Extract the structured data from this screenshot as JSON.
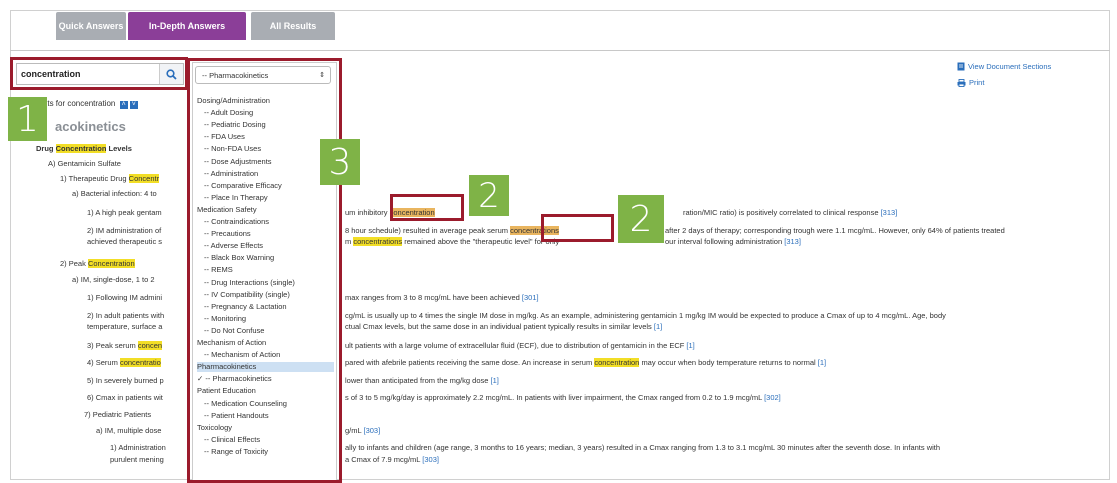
{
  "tabs": [
    "Quick Answers",
    "In-Depth Answers",
    "All Results"
  ],
  "search": {
    "value": "concentration"
  },
  "results_header": "results for concentration",
  "section_heading": "acokinetics",
  "subheading_prefix": "Drug",
  "subheading_hl": "Concentration",
  "subheading_suffix": "Levels",
  "dropdown": {
    "selected": "-- Pharmacokinetics",
    "items": [
      {
        "label": "Dosing/Administration",
        "child": false
      },
      {
        "label": "-- Adult Dosing",
        "child": true
      },
      {
        "label": "-- Pediatric Dosing",
        "child": true
      },
      {
        "label": "-- FDA Uses",
        "child": true
      },
      {
        "label": "-- Non-FDA Uses",
        "child": true
      },
      {
        "label": "-- Dose Adjustments",
        "child": true
      },
      {
        "label": "-- Administration",
        "child": true
      },
      {
        "label": "-- Comparative Efficacy",
        "child": true
      },
      {
        "label": "-- Place In Therapy",
        "child": true
      },
      {
        "label": "Medication Safety",
        "child": false
      },
      {
        "label": "-- Contraindications",
        "child": true
      },
      {
        "label": "-- Precautions",
        "child": true
      },
      {
        "label": "-- Adverse Effects",
        "child": true
      },
      {
        "label": "-- Black Box Warning",
        "child": true
      },
      {
        "label": "-- REMS",
        "child": true
      },
      {
        "label": "-- Drug Interactions (single)",
        "child": true
      },
      {
        "label": "-- IV Compatibility (single)",
        "child": true
      },
      {
        "label": "-- Pregnancy & Lactation",
        "child": true
      },
      {
        "label": "-- Monitoring",
        "child": true
      },
      {
        "label": "-- Do Not Confuse",
        "child": true
      },
      {
        "label": "Mechanism of Action",
        "child": false
      },
      {
        "label": "-- Mechanism of Action",
        "child": true
      },
      {
        "label": "Pharmacokinetics",
        "child": false,
        "selected": true
      },
      {
        "label": "✓ -- Pharmacokinetics",
        "child": false
      },
      {
        "label": "Patient Education",
        "child": false
      },
      {
        "label": "-- Medication Counseling",
        "child": true
      },
      {
        "label": "-- Patient Handouts",
        "child": true
      },
      {
        "label": "Toxicology",
        "child": false
      },
      {
        "label": "-- Clinical Effects",
        "child": true
      },
      {
        "label": "-- Range of Toxicity",
        "child": true
      }
    ]
  },
  "doc_links": {
    "view_sections": "View Document Sections",
    "print": "Print"
  },
  "callouts": [
    "1",
    "2",
    "3",
    "2"
  ],
  "content": {
    "l1": "A) Gentamicin Sulfate",
    "l2a": "1) Therapeutic Drug",
    "l2hl": "Concentr",
    "l3": "a) Bacterial infection: 4 to",
    "l4a": "1) A high peak gentam",
    "l4b": "um inhibitory",
    "l4hl": "concentration",
    "l4c": "ration/MIC ratio) is positively correlated to clinical response",
    "l4ref": "[313]",
    "l5a": "2) IM administration of",
    "l5b": "8 hour schedule) resulted in average peak serum",
    "l5hl": "concentrations",
    "l5c": "after 2 days of therapy; corresponding trough were 1.1 mcg/mL. However, only 64% of patients treated",
    "l6a": "achieved therapeutic s",
    "l6b": "m",
    "l6hl": "concentrations",
    "l6c": "remained above the \"therapeutic level\" for only",
    "l6d": "our interval following administration",
    "l6ref": "[313]",
    "l7a": "2) Peak",
    "l7hl": "Concentration",
    "l8": "a) IM, single-dose, 1 to 2",
    "l9a": "1) Following IM admini",
    "l9b": "max ranges from 3 to 8 mcg/mL have been achieved",
    "l9ref": "[301]",
    "l10a": "2) In adult patients with",
    "l10b": "cg/mL is usually up to 4 times the single IM dose in mg/kg. As an example, administering gentamicin 1 mg/kg IM would be expected to produce a Cmax of up to 4 mcg/mL. Age, body",
    "l11a": "temperature, surface a",
    "l11b": "ctual Cmax levels, but the same dose in an individual patient typically results in similar levels",
    "l11ref": "[1]",
    "l12a": "3) Peak serum",
    "l12hl": "concen",
    "l12b": "ult patients with a large volume of extracellular fluid (ECF), due to distribution of gentamicin in the ECF",
    "l12ref": "[1]",
    "l13a": "4) Serum",
    "l13hl": "concentratio",
    "l13b": "pared with afebrile patients receiving the same dose. An increase in serum",
    "l13hl2": "concentration",
    "l13c": "may occur when body temperature returns to normal",
    "l13ref": "[1]",
    "l14a": "5) In severely burned p",
    "l14b": "lower than anticipated from the mg/kg dose",
    "l14ref": "[1]",
    "l15a": "6) Cmax in patients wit",
    "l15b": "s of 3 to 5 mg/kg/day is approximately 2.2 mcg/mL. In patients with liver impairment, the Cmax ranged from 0.2 to 1.9 mcg/mL",
    "l15ref": "[302]",
    "l16": "7) Pediatric Patients",
    "l17a": "a) IM, multiple dose",
    "l17b": "g/mL",
    "l17ref": "[303]",
    "l18a": "1) Administration",
    "l18b": "ally to infants and children (age range, 3 months to 16 years; median, 3 years) resulted in a Cmax ranging from 1.3 to 3.1 mcg/mL 30 minutes after the seventh dose. In infants with",
    "l19a": "purulent mening",
    "l19b": "a Cmax of 7.9 mcg/mL",
    "l19ref": "[303]"
  }
}
